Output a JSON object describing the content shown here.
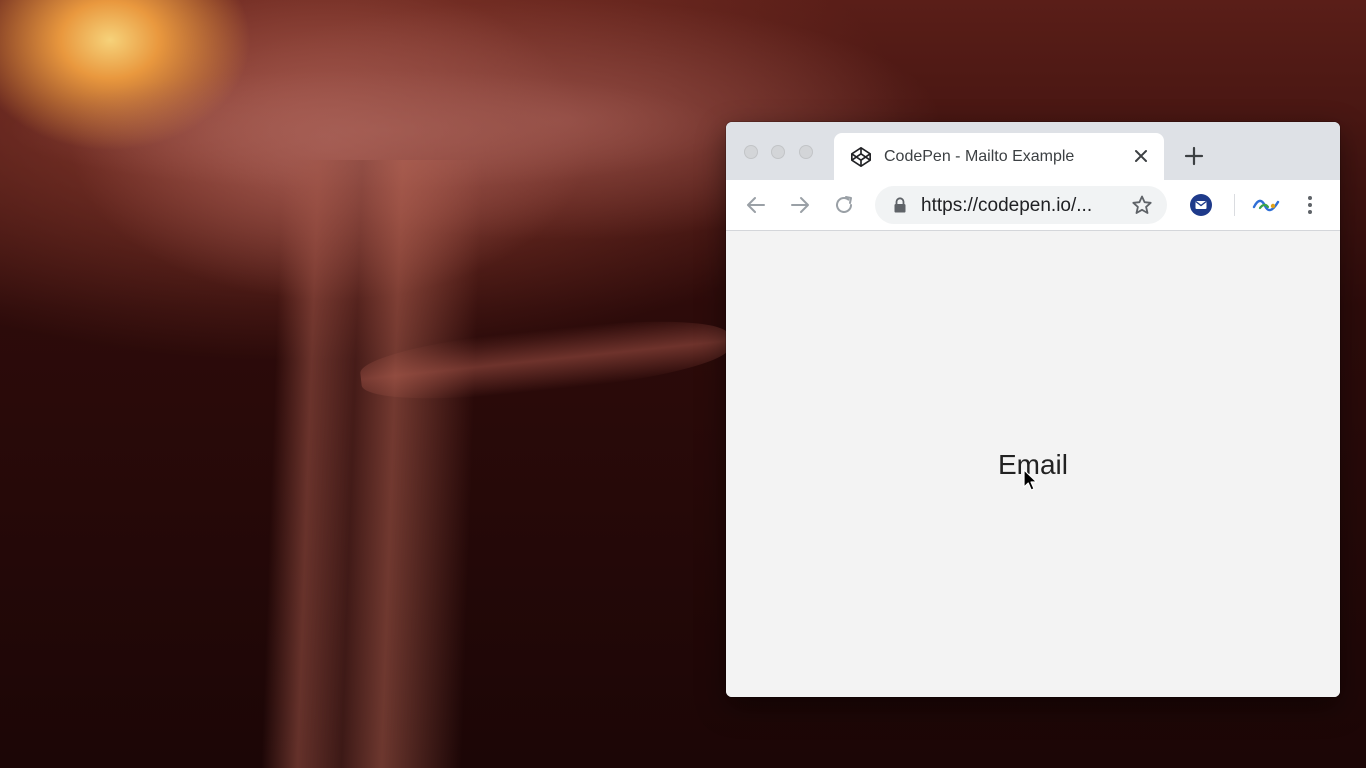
{
  "browser": {
    "tab": {
      "title": "CodePen - Mailto Example",
      "favicon": "codepen-icon"
    },
    "new_tab_icon": "plus-icon",
    "toolbar": {
      "back_icon": "back-arrow-icon",
      "forward_icon": "forward-arrow-icon",
      "reload_icon": "reload-icon",
      "url": "https://codepen.io/...",
      "secure_icon": "lock-icon",
      "bookmark_icon": "star-icon",
      "extensions": [
        "mail-extension-icon",
        "extension-icon"
      ],
      "menu_icon": "kebab-menu-icon"
    }
  },
  "page": {
    "link_text": "Email"
  },
  "colors": {
    "tabstrip": "#dee1e6",
    "page_background": "#f3f3f3",
    "mail_extension": "#1e3a8a"
  }
}
